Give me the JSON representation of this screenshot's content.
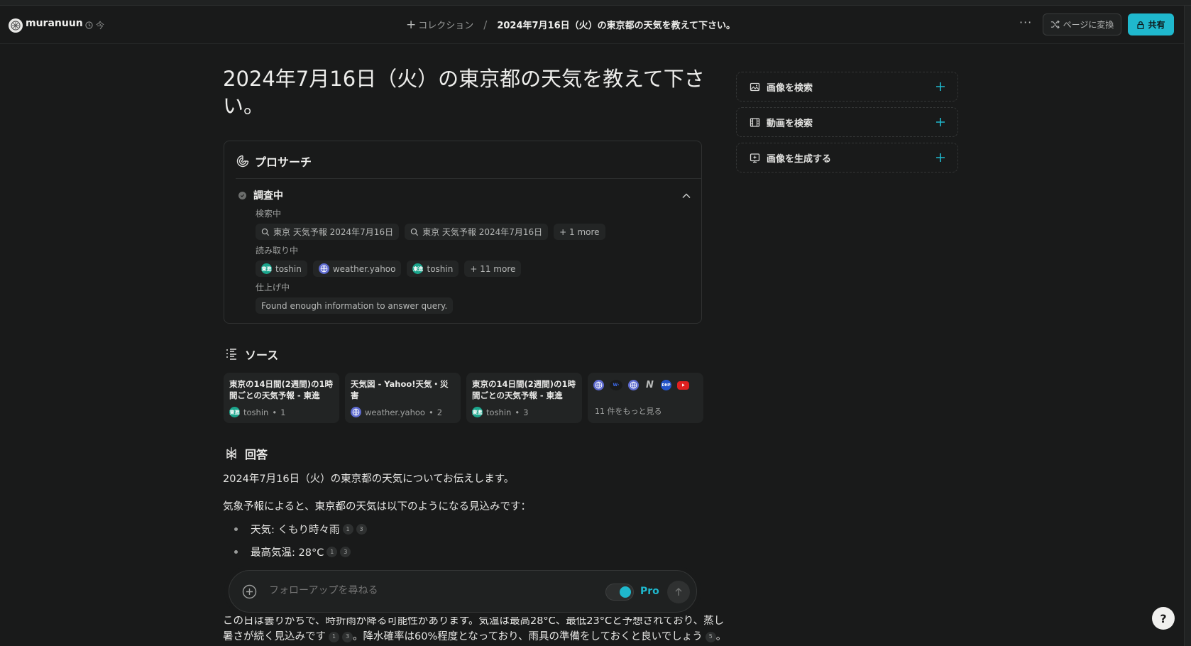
{
  "header": {
    "username": "muranuun",
    "time": "今",
    "collection_label": "コレクション",
    "separator": "/",
    "thread_title": "2024年7月16日（火）の東京都の天気を教えて下さい。",
    "convert_label": "ページに変換",
    "share_label": "共有"
  },
  "question": "2024年7月16日（火）の東京都の天気を教えて下さい。",
  "research": {
    "title": "プロサーチ",
    "status": "調査中",
    "searching_label": "検索中",
    "search_chips": [
      "東京 天気予報 2024年7月16日",
      "東京 天気予報 2024年7月16日",
      "+ 1 more"
    ],
    "reading_label": "読み取り中",
    "reading_chips": [
      {
        "name": "toshin",
        "icon": "toshin-favicon"
      },
      {
        "name": "weather.yahoo",
        "icon": "globe-icon"
      },
      {
        "name": "toshin",
        "icon": "toshin-favicon"
      },
      {
        "name": "+ 11 more",
        "icon": ""
      }
    ],
    "toshin_badge": "東進",
    "finishing_label": "仕上げ中",
    "finishing_text": "Found enough information to answer query."
  },
  "sources": {
    "title": "ソース",
    "cards": [
      {
        "title": "東京の14日間(2週間)の1時間ごとの天気予報 - 東進",
        "site": "toshin",
        "index": "1"
      },
      {
        "title": "天気図 - Yahoo!天気・災害",
        "site": "weather.yahoo",
        "index": "2"
      },
      {
        "title": "東京の14日間(2週間)の1時間ごとの天気予報 - 東進",
        "site": "toshin",
        "index": "3"
      }
    ],
    "more_label": "11 件をもっと見る",
    "more_icons": [
      "globe",
      "wm",
      "globe",
      "N",
      "DHP",
      "youtube"
    ],
    "more_icon_texts": {
      "wm": "W·",
      "n": "N",
      "dhp": "DHP"
    }
  },
  "answer": {
    "title": "回答",
    "intro": "2024年7月16日（火）の東京都の天気についてお伝えします。",
    "lead": "気象予報によると、東京都の天気は以下のようになる見込みです：",
    "bullets": [
      {
        "text": "天気: くもり時々雨",
        "cites": [
          "1",
          "3"
        ]
      },
      {
        "text": "最高気温: 28°C",
        "cites": [
          "1",
          "3"
        ]
      }
    ],
    "para_line1": "この日は曇りがちで、時折雨が降る可能性があります。気温は最高28°C、最低23°Cと予想されており、蒸し",
    "para_line2_a": "暑さが続く見込みです",
    "para_line2_cites": [
      "1",
      "3"
    ],
    "para_line2_b": "。降水確率は60%程度となっており、雨具の準備をしておくと良いでしょう",
    "para_line2_cite_end": "5",
    "para_line2_c": "。"
  },
  "followup": {
    "placeholder": "フォローアップを尋ねる",
    "pro_label": "Pro",
    "pro_enabled": true
  },
  "sidebar": {
    "items": [
      {
        "label": "画像を検索",
        "icon": "image-icon"
      },
      {
        "label": "動画を検索",
        "icon": "video-icon"
      },
      {
        "label": "画像を生成する",
        "icon": "generate-image-icon"
      }
    ]
  },
  "help_label": "?",
  "colors": {
    "accent": "#1fb8cd",
    "background": "#191a1a"
  }
}
